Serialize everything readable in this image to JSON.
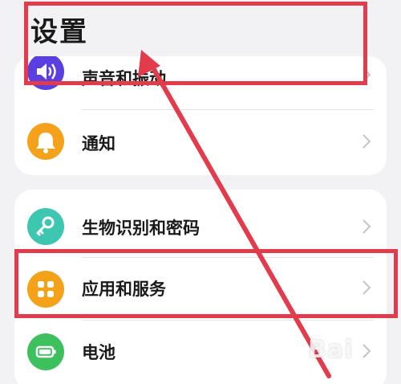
{
  "page": {
    "title": "设置"
  },
  "colors": {
    "sound": "#5b3fe0",
    "notify": "#f5a21b",
    "biometric": "#3dc6b0",
    "apps": "#f5a21b",
    "battery": "#3cc15e",
    "annotation": "#e23b4c"
  },
  "groups": [
    {
      "items": [
        {
          "label": "声音和振动",
          "icon": "speaker-icon"
        },
        {
          "label": "通知",
          "icon": "bell-icon"
        }
      ]
    },
    {
      "items": [
        {
          "label": "生物识别和密码",
          "icon": "key-icon"
        },
        {
          "label": "应用和服务",
          "icon": "grid-icon"
        },
        {
          "label": "电池",
          "icon": "battery-icon"
        }
      ]
    }
  ],
  "watermark": {
    "text": "Bai"
  }
}
